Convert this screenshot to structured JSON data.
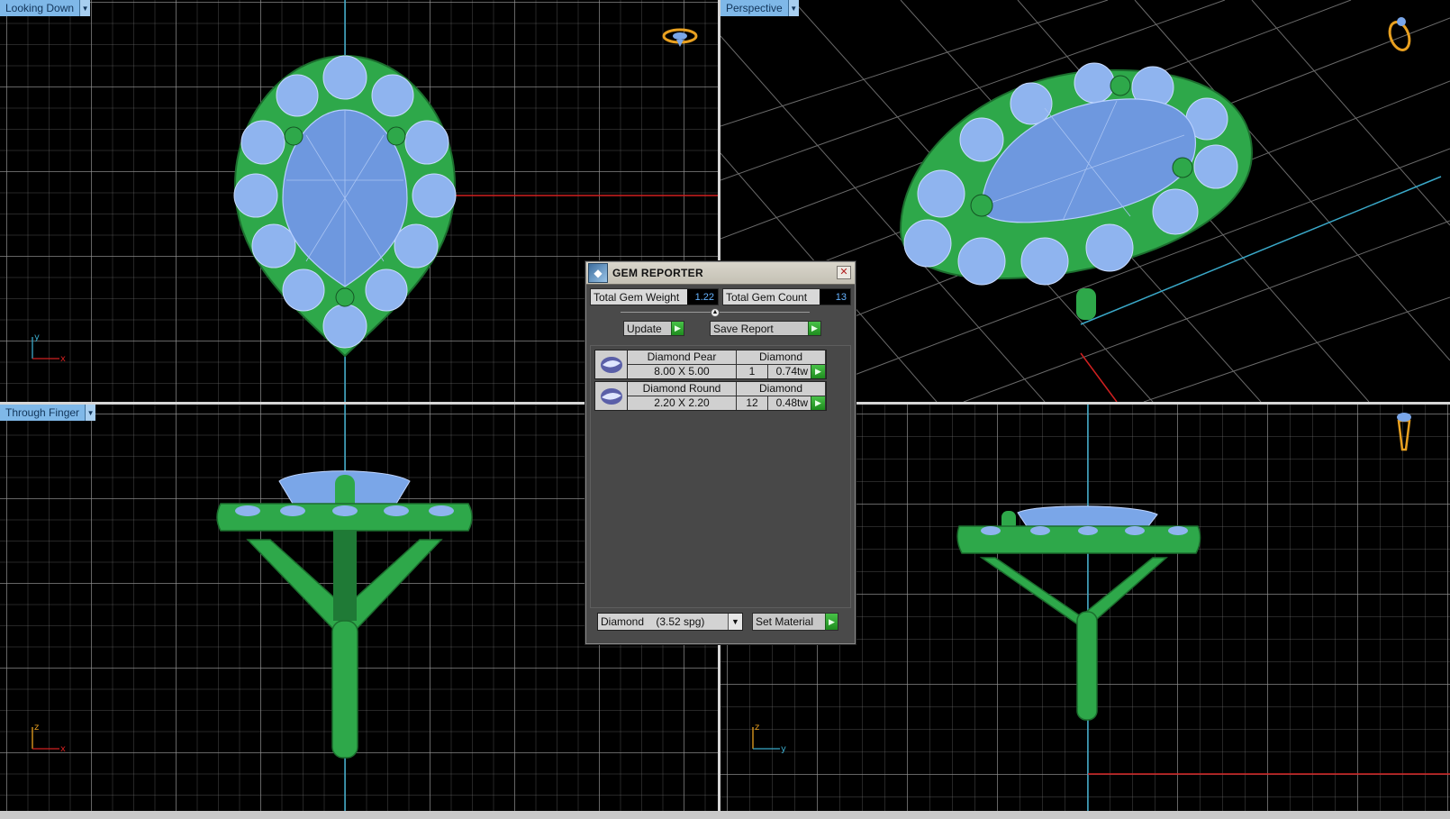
{
  "viewports": {
    "top": {
      "label": "Looking Down",
      "axes": [
        "y",
        "x"
      ]
    },
    "perspective": {
      "label": "Perspective"
    },
    "front": {
      "label": "Through Finger",
      "axes": [
        "z",
        "x"
      ]
    },
    "side": {
      "axes": [
        "z",
        "y"
      ]
    }
  },
  "gem_reporter": {
    "title": "GEM REPORTER",
    "total_weight_label": "Total Gem Weight",
    "total_weight_value": "1.22",
    "total_count_label": "Total Gem Count",
    "total_count_value": "13",
    "update_label": "Update",
    "save_report_label": "Save Report",
    "gems": [
      {
        "name": "Diamond Pear",
        "material": "Diamond",
        "size": "8.00 X 5.00",
        "qty": "1",
        "weight": "0.74tw"
      },
      {
        "name": "Diamond Round",
        "material": "Diamond",
        "size": "2.20 X 2.20",
        "qty": "12",
        "weight": "0.48tw"
      }
    ],
    "material_select": "Diamond    (3.52 spg)",
    "set_material_label": "Set Material"
  },
  "colors": {
    "metal": "#2ea84a",
    "gem": "#7aa6e8",
    "viewport_label_bg": "#7fb8e8",
    "action_green": "#2aa82a"
  }
}
